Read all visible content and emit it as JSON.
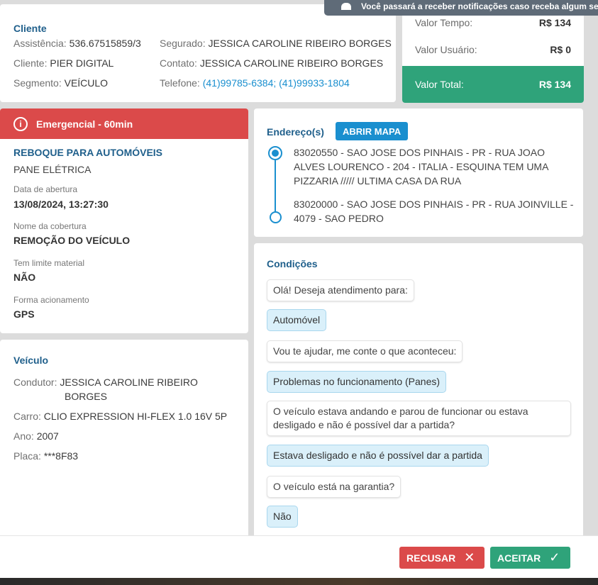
{
  "toast": {
    "text": "Você passará a receber notificações caso receba algum se"
  },
  "cliente": {
    "title": "Cliente",
    "assistencia_label": "Assistência:",
    "assistencia_value": "536.67515859/3",
    "cliente_label": "Cliente:",
    "cliente_value": "PIER DIGITAL",
    "segmento_label": "Segmento:",
    "segmento_value": "VEÍCULO",
    "segurado_label": "Segurado:",
    "segurado_value": "JESSICA CAROLINE RIBEIRO BORGES",
    "contato_label": "Contato:",
    "contato_value": "JESSICA CAROLINE RIBEIRO BORGES",
    "telefone_label": "Telefone:",
    "telefone_value": "(41)99785-6384; (41)99933-1804"
  },
  "valores": {
    "tempo_label": "Valor Tempo:",
    "tempo_value": "R$ 134",
    "usuario_label": "Valor Usuário:",
    "usuario_value": "R$ 0",
    "total_label": "Valor Total:",
    "total_value": "R$ 134"
  },
  "servico": {
    "badge": "Emergencial - 60min",
    "tipo": "REBOQUE PARA AUTOMÓVEIS",
    "problema": "PANE ELÉTRICA",
    "data_label": "Data de abertura",
    "data_value": "13/08/2024, 13:27:30",
    "cobertura_label": "Nome da cobertura",
    "cobertura_value": "REMOÇÃO DO VEÍCULO",
    "limite_label": "Tem limite material",
    "limite_value": "NÃO",
    "forma_label": "Forma acionamento",
    "forma_value": "GPS"
  },
  "veiculo": {
    "title": "Veículo",
    "condutor_label": "Condutor:",
    "condutor_value_line1": "JESSICA CAROLINE RIBEIRO",
    "condutor_value_line2": "BORGES",
    "carro_label": "Carro:",
    "carro_value": "CLIO EXPRESSION HI-FLEX 1.0 16V 5P",
    "ano_label": "Ano:",
    "ano_value": "2007",
    "placa_label": "Placa:",
    "placa_value": "***8F83"
  },
  "endereco": {
    "title": "Endereço(s)",
    "map_button": "ABRIR MAPA",
    "origem": "83020550 - SAO JOSE DOS PINHAIS - PR - RUA JOAO ALVES LOURENCO - 204 - ITALIA - ESQUINA TEM UMA PIZZARIA ///// ULTIMA CASA DA RUA",
    "destino": "83020000 - SAO JOSE DOS PINHAIS - PR - RUA JOINVILLE - 4079 - SAO PEDRO"
  },
  "condicoes": {
    "title": "Condições",
    "messages": [
      {
        "text": "Olá! Deseja atendimento para:"
      },
      {
        "text": "Automóvel"
      },
      {
        "text": "Vou te ajudar, me conte o que aconteceu:"
      },
      {
        "text": "Problemas no funcionamento (Panes)"
      },
      {
        "text": "O veículo estava andando e parou de funcionar ou estava desligado e não é possível dar a partida?"
      },
      {
        "text": "Estava desligado e não é possível dar a partida"
      },
      {
        "text": "O veículo está na garantia?"
      },
      {
        "text": "Não"
      }
    ]
  },
  "footer": {
    "recusar_label": "RECUSAR",
    "aceitar_label": "ACEITAR"
  },
  "colors": {
    "accent": "#1a8fcf",
    "success": "#2fa37a",
    "danger": "#db4a4a",
    "title": "#1f5f8b"
  }
}
